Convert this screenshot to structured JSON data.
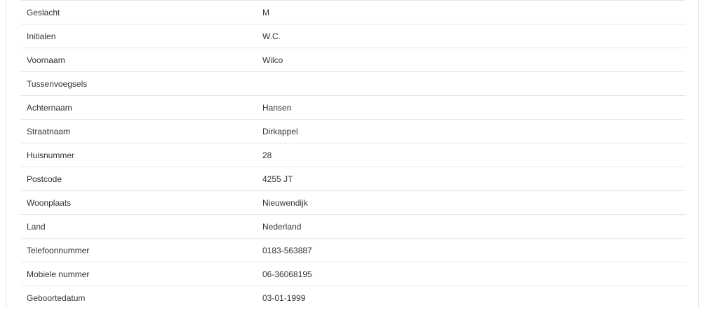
{
  "details": {
    "rows": [
      {
        "label": "Geslacht",
        "value": "M"
      },
      {
        "label": "Initialen",
        "value": "W.C."
      },
      {
        "label": "Voornaam",
        "value": "Wilco"
      },
      {
        "label": "Tussenvoegsels",
        "value": ""
      },
      {
        "label": "Achternaam",
        "value": "Hansen"
      },
      {
        "label": "Straatnaam",
        "value": "Dirkappel"
      },
      {
        "label": "Huisnummer",
        "value": "28"
      },
      {
        "label": "Postcode",
        "value": "4255 JT"
      },
      {
        "label": "Woonplaats",
        "value": "Nieuwendijk"
      },
      {
        "label": "Land",
        "value": "Nederland"
      },
      {
        "label": "Telefoonnummer",
        "value": "0183-563887"
      },
      {
        "label": "Mobiele nummer",
        "value": "06-36068195"
      },
      {
        "label": "Geboortedatum",
        "value": "03-01-1999"
      }
    ]
  }
}
